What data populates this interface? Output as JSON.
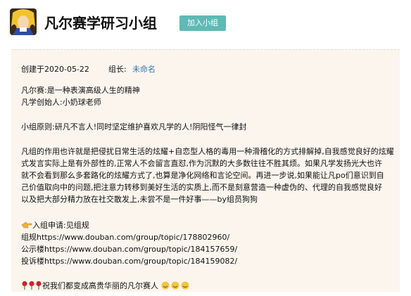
{
  "header": {
    "title": "凡尔赛学研习小组",
    "join_label": "加入小组"
  },
  "meta": {
    "created": "创建于2020-05-22",
    "leader_label": "组长:",
    "leader_name": "未命名"
  },
  "body": {
    "line1": "凡尔赛:是一种表演高级人生的精神",
    "line2": "凡学创始人:小奶球老师",
    "principle": "小组原则:研凡不言人!同时坚定维护喜欢凡学的人!阴阳怪气一律封",
    "para": [
      "凡组的作用也许就是把侵扰日常生活的炫耀+自恋型人格的毒用一种滑稽化的方式排解掉,自我感觉良好的炫耀",
      "式发言实际上是有外部性的,正常人不会留言直怼,作为沉默的大多数往往不胜其烦。如果凡学发扬光大也许",
      "就不会看到那么多套路化的炫耀方式了,也算是净化网络和言论空间。再进一步说,如果能让凡po们意识到自",
      "己价值取向中的问题,把注意力转移到美好生活的实质上,而不是刻意营造一种虚伪的、代理的自我感觉良好",
      "以及把大部分精力放在社交散发上,未尝不是一件好事——by组员狗狗"
    ],
    "apply": "入组申请:见组规",
    "rules_link": "组规https://www.douban.com/group/topic/178802960/",
    "notice_link": "公示楼https://www.douban.com/group/topic/184157659/",
    "complaint_link": "投诉楼https://www.douban.com/group/topic/184159082/",
    "wish": "祝我们都变成高贵华丽的凡尔赛人"
  }
}
